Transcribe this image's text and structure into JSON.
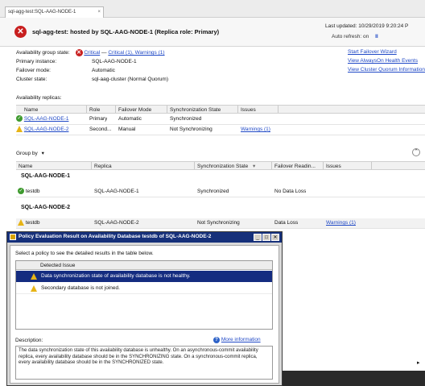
{
  "tab": {
    "title": "sql-agg-test:SQL-AAG-NODE-1",
    "close": "×"
  },
  "header": {
    "title": "sql-agg-test: hosted by SQL-AAG-NODE-1 (Replica role: Primary)",
    "last_updated_label": "Last updated:",
    "last_updated_value": "10/29/2019 9:20:24 P",
    "auto_refresh_label": "Auto refresh: on",
    "pause_glyph": "II"
  },
  "summary": {
    "rows": [
      {
        "label": "Availability group state:",
        "value_critical": "Critical",
        "value_sep": " — ",
        "value_link": "Critical (1), Warnings (1)"
      },
      {
        "label": "Primary instance:",
        "value": "SQL-AAG-NODE-1"
      },
      {
        "label": "Failover mode:",
        "value": "Automatic"
      },
      {
        "label": "Cluster state:",
        "value": "sql-aag-cluster (Normal Quorum)"
      }
    ],
    "links": [
      "Start Failover Wizard",
      "View AlwaysOn Health Events",
      "View Cluster Quorum Information"
    ]
  },
  "replicas": {
    "section_title": "Availability replicas:",
    "columns": [
      "Name",
      "Role",
      "Failover Mode",
      "Synchronization State",
      "Issues"
    ],
    "rows": [
      {
        "status": "ok",
        "name": "SQL-AAG-NODE-1",
        "role": "Primary",
        "failover": "Automatic",
        "sync": "Synchronized",
        "issues": ""
      },
      {
        "status": "warn",
        "name": "SQL-AAG-NODE-2",
        "role": "Second...",
        "failover": "Manual",
        "sync": "Not Synchronizing",
        "issues": "Warnings (1)"
      }
    ]
  },
  "databases": {
    "group_by": "Group by",
    "group_by_arrow": "▾",
    "columns": [
      "Name",
      "Replica",
      "Synchronization State",
      "Failover Readin...",
      "Issues"
    ],
    "sort_glyph": "▾",
    "groups": [
      {
        "title": "SQL-AAG-NODE-1",
        "rows": [
          {
            "status": "ok",
            "name": "testdb",
            "replica": "SQL-AAG-NODE-1",
            "sync": "Synchronized",
            "failover": "No Data Loss",
            "issues": ""
          }
        ]
      },
      {
        "title": "SQL-AAG-NODE-2",
        "rows": [
          {
            "status": "warn",
            "name": "testdb",
            "replica": "SQL-AAG-NODE-2",
            "sync": "Not Synchronizing",
            "failover": "Data Loss",
            "issues": "Warnings (1)"
          }
        ]
      }
    ]
  },
  "dialog": {
    "title": "Policy Evaluation Result on Availability Database testdb of SQL-AAG-NODE-2",
    "instruction": "Select a policy to see the detailed results in the table below.",
    "column": "Detected Issue",
    "issues": [
      {
        "text": "Data synchronization state of availability database is not healthy.",
        "selected": true
      },
      {
        "text": "Secondary database is not joined.",
        "selected": false
      }
    ],
    "description_label": "Description:",
    "more_info": "More information",
    "description_text": "The data synchronization state of this availability database is unhealthy. On an asynchronous-commit availability replica, every availability database should be in the SYNCHRONIZING state. On a synchronous-commit replica, every availability database should be in the SYNCHRONIZED state.",
    "buttons": [
      "_",
      "□",
      "✕"
    ]
  },
  "colors": {
    "dialog_title_bar": "#16307a",
    "selected_row": "#142c80",
    "link": "#1f48c6",
    "critical_red": "#c81f1f",
    "warning_yellow": "#e7b416",
    "ok_green": "#3e9a2e"
  }
}
